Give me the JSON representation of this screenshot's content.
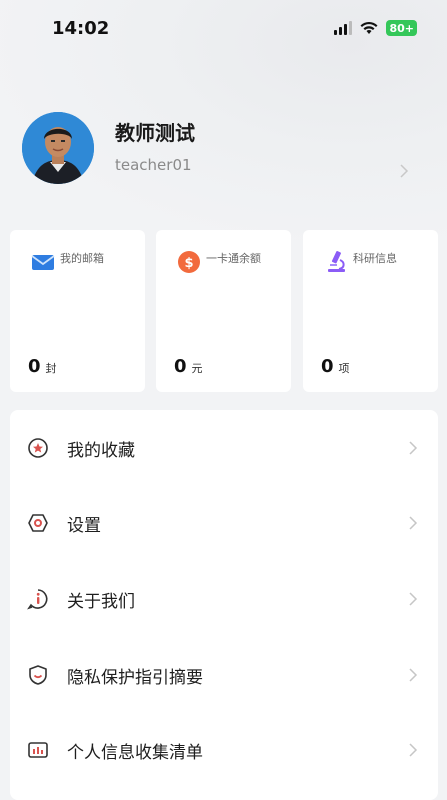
{
  "status_bar": {
    "time": "14:02",
    "battery": "80+"
  },
  "profile": {
    "name": "教师测试",
    "user_id": "teacher01"
  },
  "cards": [
    {
      "label": "我的邮箱",
      "value": "0",
      "unit": "封",
      "icon": "mail-icon",
      "color": "#2f7de1"
    },
    {
      "label": "一卡通余额",
      "value": "0",
      "unit": "元",
      "icon": "coin-icon",
      "color": "#f26a3d"
    },
    {
      "label": "科研信息",
      "value": "0",
      "unit": "项",
      "icon": "microscope-icon",
      "color": "#8b5cf6"
    }
  ],
  "menu": [
    {
      "label": "我的收藏",
      "icon": "star-icon"
    },
    {
      "label": "设置",
      "icon": "gear-icon"
    },
    {
      "label": "关于我们",
      "icon": "info-icon"
    },
    {
      "label": "隐私保护指引摘要",
      "icon": "shield-icon"
    },
    {
      "label": "个人信息收集清单",
      "icon": "list-icon"
    }
  ],
  "colors": {
    "accent_red": "#d9534f",
    "battery_green": "#34c759"
  }
}
